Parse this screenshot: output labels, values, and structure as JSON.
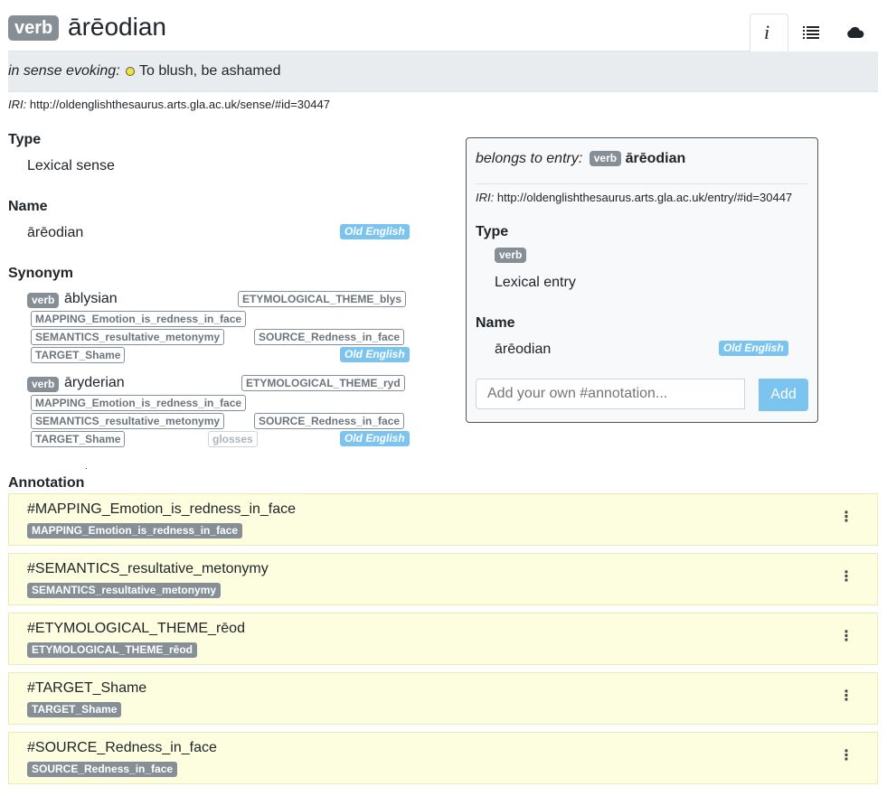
{
  "header": {
    "pos_badge": "verb",
    "title": "ārēodian",
    "toolbar_icons": [
      "info-icon",
      "list-icon",
      "cloud-icon"
    ]
  },
  "sense_bar": {
    "prefix": "in sense evoking:",
    "text": "To blush, be ashamed"
  },
  "iri": {
    "label": "IRI:",
    "value": "http://oldenglishthesaurus.arts.gla.ac.uk/sense/#id=30447"
  },
  "type": {
    "heading": "Type",
    "value": "Lexical sense"
  },
  "name": {
    "heading": "Name",
    "value": "ārēodian",
    "lang": "Old English"
  },
  "synonym": {
    "heading": "Synonym",
    "items": [
      {
        "pos": "verb",
        "word": "āblysian",
        "tags": [
          "ETYMOLOGICAL_THEME_blys",
          "MAPPING_Emotion_is_redness_in_face",
          "SEMANTICS_resultative_metonymy",
          "SOURCE_Redness_in_face",
          "TARGET_Shame"
        ],
        "lang": "Old English"
      },
      {
        "pos": "verb",
        "word": "āryderian",
        "tags": [
          "ETYMOLOGICAL_THEME_ryd",
          "MAPPING_Emotion_is_redness_in_face",
          "SEMANTICS_resultative_metonymy",
          "SOURCE_Redness_in_face",
          "TARGET_Shame",
          "glosses"
        ],
        "lang": "Old English"
      }
    ]
  },
  "entry_panel": {
    "prefix": "belongs to entry:",
    "pos": "verb",
    "word": "ārēodian",
    "iri_label": "IRI:",
    "iri_value": "http://oldenglishthesaurus.arts.gla.ac.uk/entry/#id=30447",
    "type_heading": "Type",
    "type_pos": "verb",
    "type_value": "Lexical entry",
    "name_heading": "Name",
    "name_value": "ārēodian",
    "name_lang": "Old English",
    "annotation_placeholder": "Add your own #annotation...",
    "add_label": "Add"
  },
  "annotation": {
    "heading": "Annotation",
    "items": [
      {
        "title": "#MAPPING_Emotion_is_redness_in_face",
        "tag": "MAPPING_Emotion_is_redness_in_face",
        "menu": "⋮"
      },
      {
        "title": "#SEMANTICS_resultative_metonymy",
        "tag": "SEMANTICS_resultative_metonymy",
        "menu": "⋮"
      },
      {
        "title": "#ETYMOLOGICAL_THEME_rēod",
        "tag": "ETYMOLOGICAL_THEME_rēod",
        "menu": "⋮"
      },
      {
        "title": "#TARGET_Shame",
        "tag": "TARGET_Shame",
        "menu": "⋮"
      },
      {
        "title": "#SOURCE_Redness_in_face",
        "tag": "SOURCE_Redness_in_face",
        "menu": "⋮"
      }
    ]
  },
  "colors": {
    "badge_gray": "#868e96",
    "lang_blue": "#7cc4f0",
    "sense_dot": "#e8e83a",
    "annotation_bg": "#fdfde0"
  }
}
